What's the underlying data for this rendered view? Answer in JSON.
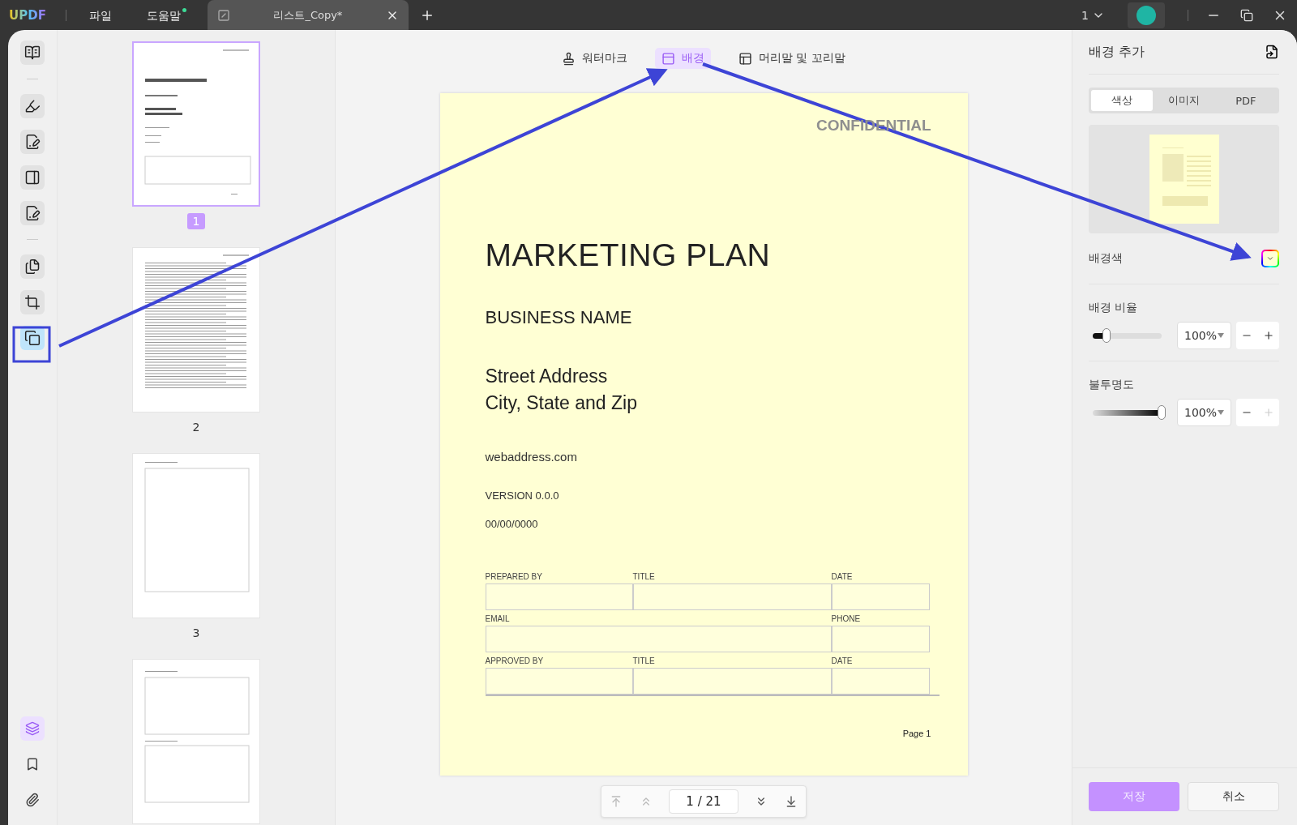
{
  "titlebar": {
    "logo": "UPDF",
    "menus": [
      {
        "label": "파일",
        "badge": false
      },
      {
        "label": "도움말",
        "badge": true
      }
    ],
    "tab": {
      "title": "리스트_Copy*"
    },
    "account": "1"
  },
  "left_tools": [
    {
      "kind": "reader",
      "selected": false
    },
    {
      "kind": "comment",
      "selected": false
    },
    {
      "kind": "edit",
      "selected": false
    },
    {
      "kind": "form",
      "selected": false
    },
    {
      "kind": "sign",
      "selected": false
    },
    {
      "kind": "organize",
      "selected": false
    },
    {
      "kind": "crop",
      "selected": false
    },
    {
      "kind": "page-tools",
      "selected": true
    }
  ],
  "bottom_tools": [
    {
      "kind": "layers",
      "selected": true
    },
    {
      "kind": "bookmark",
      "selected": false
    },
    {
      "kind": "attachment",
      "selected": false
    }
  ],
  "thumbnails": [
    {
      "kind": "cover",
      "label": "1",
      "selected": true
    },
    {
      "kind": "contents",
      "label": "2",
      "selected": false
    },
    {
      "kind": "summary",
      "label": "3",
      "selected": false
    },
    {
      "kind": "sections",
      "selected": false
    }
  ],
  "toolbar": [
    {
      "label": "워터마크",
      "selected": false
    },
    {
      "label": "배경",
      "selected": true
    },
    {
      "label": "머리말 및 꼬리말",
      "selected": false
    }
  ],
  "document": {
    "confidential": "CONFIDENTIAL",
    "title": "MARKETING PLAN",
    "business": "BUSINESS NAME",
    "address": [
      "Street Address",
      "City, State and Zip"
    ],
    "web": "webaddress.com",
    "version": "VERSION 0.0.0",
    "date": "00/00/0000",
    "form": [
      {
        "cells": [
          "PREPARED BY",
          "TITLE",
          "DATE"
        ]
      },
      {
        "cells": [
          "EMAIL",
          "PHONE"
        ]
      },
      {
        "cells": [
          "APPROVED BY",
          "TITLE",
          "DATE"
        ]
      }
    ],
    "footer": "Page 1"
  },
  "pager": {
    "value": "1 / 21"
  },
  "panel": {
    "title": "배경 추가",
    "tabs": [
      {
        "label": "색상",
        "selected": true
      },
      {
        "label": "이미지",
        "selected": false
      },
      {
        "label": "PDF",
        "selected": false
      }
    ],
    "color_label": "배경색",
    "ratio": {
      "label": "배경 비율",
      "level": 0.2,
      "value": "100%",
      "plus_disabled": false
    },
    "opacity": {
      "label": "불투명도",
      "level": 1,
      "value": "100%",
      "plus_disabled": true
    },
    "buttons": {
      "save": "저장",
      "cancel": "취소"
    }
  }
}
